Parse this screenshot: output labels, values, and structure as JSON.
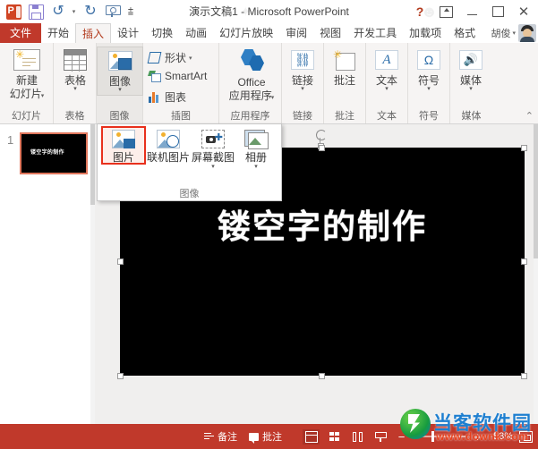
{
  "window": {
    "title": "演示文稿1 - Microsoft PowerPoint",
    "quick_access": [
      {
        "name": "powerpoint-logo",
        "label": "P"
      },
      {
        "name": "save-icon",
        "label": "保存"
      },
      {
        "name": "undo-icon",
        "label": "撤消"
      },
      {
        "name": "redo-icon",
        "label": "重复"
      },
      {
        "name": "start-presentation-icon",
        "label": "从头开始"
      },
      {
        "name": "customize-qat-icon",
        "label": "自定义快速访问工具栏"
      }
    ],
    "controls": {
      "help": "?",
      "ribbon_display": "功能区显示选项",
      "minimize": "最小化",
      "maximize": "最大化",
      "close": "关闭"
    }
  },
  "tabs": {
    "file": "文件",
    "items": [
      "开始",
      "插入",
      "设计",
      "切换",
      "动画",
      "幻灯片放映",
      "审阅",
      "视图",
      "开发工具",
      "加载项",
      "格式"
    ],
    "active": "插入"
  },
  "account": {
    "name": "胡俊",
    "caret": "▾"
  },
  "ribbon": {
    "groups": [
      {
        "label": "幻灯片",
        "buttons": [
          {
            "label": "新建\n幻灯片",
            "line1": "新建",
            "line2": "幻灯片",
            "caret": "▾",
            "icon": "new-slide-icon"
          }
        ]
      },
      {
        "label": "表格",
        "buttons": [
          {
            "line1": "表格",
            "line2": "",
            "caret": "▾",
            "icon": "table-icon"
          }
        ]
      },
      {
        "label": "图像",
        "buttons": [
          {
            "line1": "图像",
            "line2": "",
            "caret": "▾",
            "icon": "images-icon"
          }
        ]
      },
      {
        "label": "插图",
        "small_items": [
          {
            "label": "形状",
            "caret": "▾",
            "icon": "shapes-icon"
          },
          {
            "label": "SmartArt",
            "caret": "",
            "icon": "smartart-icon"
          },
          {
            "label": "图表",
            "caret": "",
            "icon": "chart-icon"
          }
        ]
      },
      {
        "label": "应用程序",
        "buttons": [
          {
            "line1": "Office",
            "line2": "应用程序",
            "caret": "▾",
            "icon": "office-apps-icon"
          }
        ]
      },
      {
        "label": "链接",
        "buttons": [
          {
            "line1": "链接",
            "line2": "",
            "caret": "▾",
            "icon": "link-icon"
          }
        ]
      },
      {
        "label": "批注",
        "buttons": [
          {
            "line1": "批注",
            "line2": "",
            "caret": "",
            "icon": "comment-icon"
          }
        ]
      },
      {
        "label": "文本",
        "buttons": [
          {
            "line1": "文本",
            "line2": "",
            "caret": "▾",
            "icon": "text-icon"
          }
        ]
      },
      {
        "label": "符号",
        "buttons": [
          {
            "line1": "符号",
            "line2": "",
            "caret": "▾",
            "icon": "symbol-icon"
          }
        ]
      },
      {
        "label": "媒体",
        "buttons": [
          {
            "line1": "媒体",
            "line2": "",
            "caret": "▾",
            "icon": "media-icon"
          }
        ]
      }
    ],
    "collapse_caret": "⌃"
  },
  "images_dropdown": {
    "group_label": "图像",
    "items": [
      {
        "label": "图片",
        "caret": "",
        "icon": "picture-icon",
        "selected": true
      },
      {
        "label": "联机图片",
        "caret": "",
        "icon": "online-pictures-icon",
        "selected": false
      },
      {
        "label": "屏幕截图",
        "caret": "▾",
        "icon": "screenshot-icon",
        "selected": false
      },
      {
        "label": "相册",
        "caret": "▾",
        "icon": "photo-album-icon",
        "selected": false
      }
    ],
    "highlight_color": "#e8301c"
  },
  "thumbnails": {
    "slides": [
      {
        "number": "1",
        "title": "镂空字的制作"
      }
    ]
  },
  "slide": {
    "title": "镂空字的制作",
    "background": "#000000"
  },
  "status_bar": {
    "notes": "备注",
    "comments": "批注",
    "views": [
      {
        "name": "normal-view",
        "label": "普通视图",
        "active": true
      },
      {
        "name": "slide-sorter-view",
        "label": "幻灯片浏览"
      },
      {
        "name": "reading-view",
        "label": "阅读视图"
      },
      {
        "name": "slide-show-view",
        "label": "幻灯片放映"
      }
    ],
    "zoom_out": "−",
    "zoom_in": "+",
    "zoom_value": "53%",
    "fit_label": "使幻灯片适应当前窗口"
  },
  "watermark": {
    "name": "当客软件园",
    "url": "www.downk.com"
  }
}
